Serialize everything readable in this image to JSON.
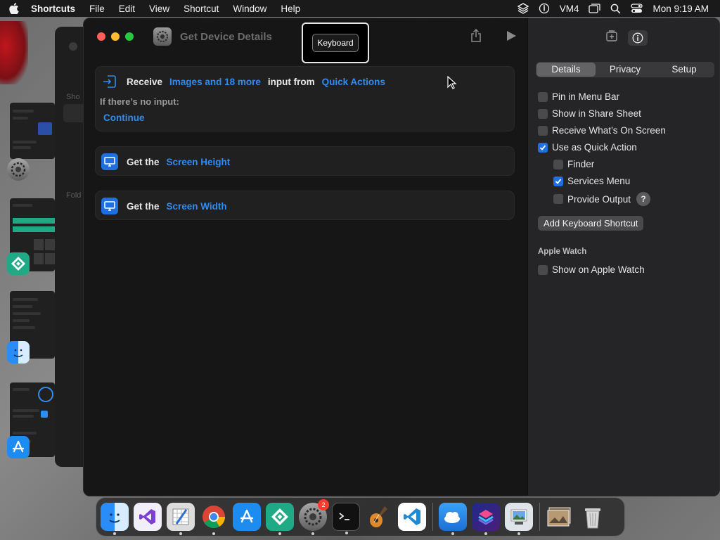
{
  "menubar": {
    "app_name": "Shortcuts",
    "items": [
      "File",
      "Edit",
      "View",
      "Shortcut",
      "Window",
      "Help"
    ],
    "status_text": "VM4",
    "clock": "Mon 9:19 AM"
  },
  "background": {
    "label_1": "Sho",
    "label_2": "Fold"
  },
  "window": {
    "title": "Get Device Details",
    "tooltip": "Keyboard"
  },
  "actions": {
    "receive": {
      "verb": "Receive",
      "types": "Images and 18 more",
      "middle": "input from",
      "source": "Quick Actions",
      "no_input_label": "If there’s no input:",
      "no_input_value": "Continue"
    },
    "height": {
      "verb": "Get the",
      "param": "Screen Height"
    },
    "width": {
      "verb": "Get the",
      "param": "Screen Width"
    }
  },
  "inspector": {
    "tabs": [
      "Details",
      "Privacy",
      "Setup"
    ],
    "active_tab": "Details",
    "options": {
      "pin_menu_bar": "Pin in Menu Bar",
      "share_sheet": "Show in Share Sheet",
      "receive_screen": "Receive What’s On Screen",
      "quick_action": "Use as Quick Action",
      "finder": "Finder",
      "services_menu": "Services Menu",
      "provide_output": "Provide Output",
      "help": "?"
    },
    "add_shortcut_button": "Add Keyboard Shortcut",
    "apple_watch_header": "Apple Watch",
    "apple_watch_option": "Show on Apple Watch"
  },
  "dock": {
    "settings_badge": "2"
  },
  "colors": {
    "accent": "#2f8cf0",
    "checkbox_on": "#1f6fe0",
    "close": "#ff5f57",
    "minimize": "#febc2e",
    "zoom": "#28c840"
  }
}
